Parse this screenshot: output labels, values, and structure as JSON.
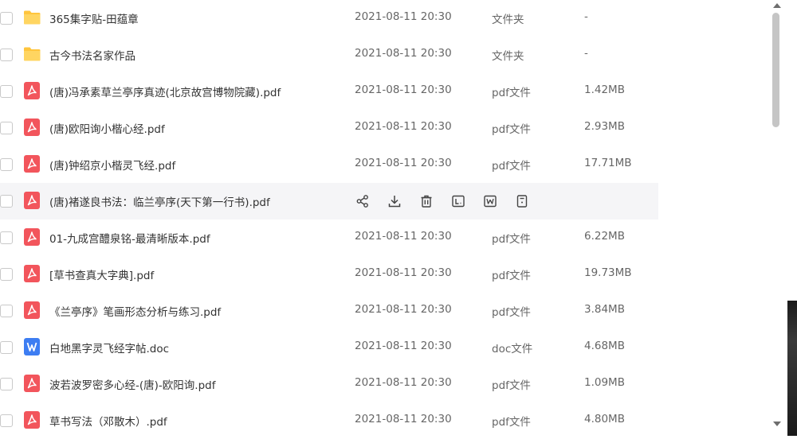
{
  "colors": {
    "folder": "#ffc53d",
    "pdf": "#f2555c",
    "doc": "#3d7df2",
    "hover_bg": "#f5f5f7"
  },
  "files": [
    {
      "name": "365集字贴-田蕴章",
      "date": "2021-08-11 20:30",
      "type": "文件夹",
      "size": "-",
      "icon": "folder-icon"
    },
    {
      "name": "古今书法名家作品",
      "date": "2021-08-11 20:30",
      "type": "文件夹",
      "size": "-",
      "icon": "folder-icon"
    },
    {
      "name": "(唐)冯承素草兰亭序真迹(北京故宫博物院藏).pdf",
      "date": "2021-08-11 20:30",
      "type": "pdf文件",
      "size": "1.42MB",
      "icon": "pdf-icon"
    },
    {
      "name": "(唐)欧阳询小楷心经.pdf",
      "date": "2021-08-11 20:30",
      "type": "pdf文件",
      "size": "2.93MB",
      "icon": "pdf-icon"
    },
    {
      "name": "(唐)钟绍京小楷灵飞经.pdf",
      "date": "2021-08-11 20:30",
      "type": "pdf文件",
      "size": "17.71MB",
      "icon": "pdf-icon"
    },
    {
      "name": "(唐)褚遂良书法：临兰亭序(天下第一行书).pdf",
      "date": "",
      "type": "",
      "size": "",
      "icon": "pdf-icon",
      "hover": true
    },
    {
      "name": "01-九成宫醴泉铭-最清晰版本.pdf",
      "date": "2021-08-11 20:30",
      "type": "pdf文件",
      "size": "6.22MB",
      "icon": "pdf-icon"
    },
    {
      "name": "[草书查真大字典].pdf",
      "date": "2021-08-11 20:30",
      "type": "pdf文件",
      "size": "19.73MB",
      "icon": "pdf-icon"
    },
    {
      "name": "《兰亭序》笔画形态分析与练习.pdf",
      "date": "2021-08-11 20:30",
      "type": "pdf文件",
      "size": "3.84MB",
      "icon": "pdf-icon"
    },
    {
      "name": "白地黑字灵飞经字帖.doc",
      "date": "2021-08-11 20:30",
      "type": "doc文件",
      "size": "4.68MB",
      "icon": "doc-icon"
    },
    {
      "name": "波若波罗密多心经-(唐)-欧阳询.pdf",
      "date": "2021-08-11 20:30",
      "type": "pdf文件",
      "size": "1.09MB",
      "icon": "pdf-icon"
    },
    {
      "name": "草书写法（邓散木）.pdf",
      "date": "2021-08-11 20:30",
      "type": "pdf文件",
      "size": "4.80MB",
      "icon": "pdf-icon"
    }
  ],
  "row_actions": [
    "share-icon",
    "download-icon",
    "delete-icon",
    "rename-icon",
    "move-icon",
    "more-info-icon"
  ]
}
